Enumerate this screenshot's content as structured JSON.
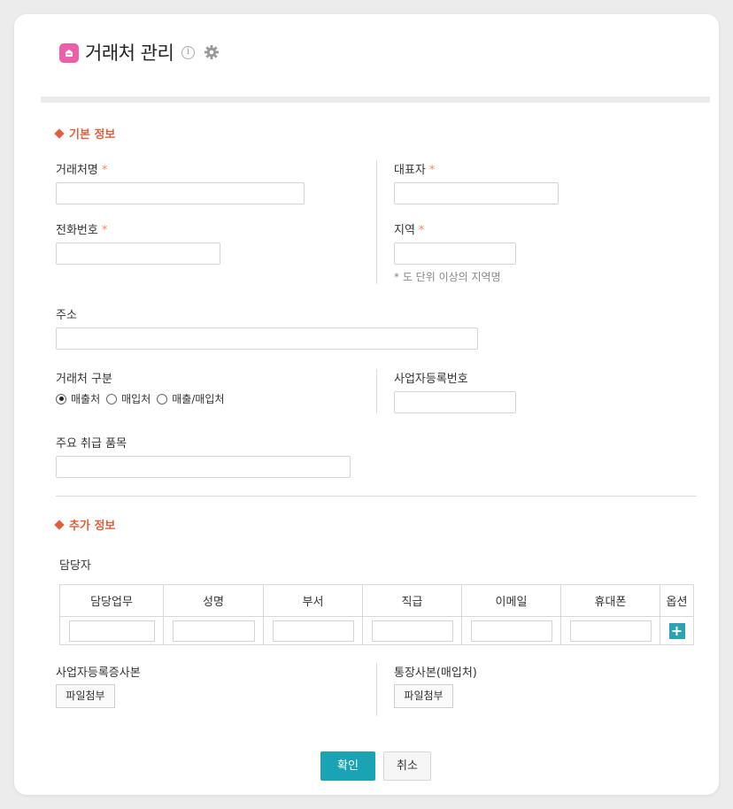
{
  "header": {
    "title": "거래처 관리",
    "info_glyph": "i"
  },
  "basic": {
    "section_title": "기본 정보",
    "client_name_label": "거래처명",
    "representative_label": "대표자",
    "phone_label": "전화번호",
    "region_label": "지역",
    "region_hint": "* 도 단위 이상의 지역명",
    "address_label": "주소",
    "client_type_label": "거래처 구분",
    "client_type_options": [
      "매출처",
      "매입처",
      "매출/매입처"
    ],
    "client_type_selected": "매출처",
    "business_number_label": "사업자등록번호",
    "main_items_label": "주요 취급 품목",
    "required_mark": "*"
  },
  "extra": {
    "section_title": "추가 정보",
    "manager_label": "담당자",
    "table_headers": [
      "담당업무",
      "성명",
      "부서",
      "직급",
      "이메일",
      "휴대폰",
      "옵션"
    ],
    "add_glyph": "+",
    "business_cert_label": "사업자등록증사본",
    "bankbook_label": "통장사본(매입처)",
    "file_attach_label": "파일첨부"
  },
  "footer": {
    "confirm_label": "확인",
    "cancel_label": "취소"
  },
  "colors": {
    "accent": "#1aa3b2",
    "section": "#e15e3e",
    "required": "#f08a64",
    "title_icon": "#ec5fa9"
  }
}
